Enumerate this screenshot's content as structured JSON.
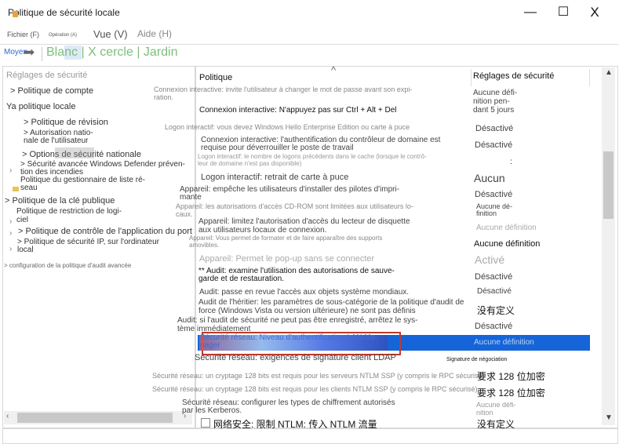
{
  "window": {
    "title": "Politique de sécurité locale",
    "minimize_label": "—",
    "maximize_label": "☐",
    "close_label": "X"
  },
  "menu": {
    "file": "Fichier (F)",
    "action": "Opération (A)",
    "view": "Vue (V)",
    "help": "Aide (H)"
  },
  "toolbar": {
    "moyen": "Moyen",
    "arrow": "➡",
    "path": "Blanc | X cercle | Jardin"
  },
  "left_tree": {
    "root": "Réglages de sécurité",
    "items": [
      "> Politique de compte",
      "Ya politique locale",
      "> Politique de révision",
      "> Autorisation natio-\nnale de l'utilisateur",
      "> Options de sécurité nationale",
      "> Sécurité avancée Windows Defender préven-\ntion des incendies",
      "Politique du gestionnaire de liste ré-\nseau",
      "> Politique de la clé publique",
      "Politique de restriction de logi-\nciel",
      "> Politique de contrôle de l'application du port",
      "> Politique de sécurité IP, sur l'ordinateur\nlocal",
      "> configuration de la politique d'audit avancée"
    ]
  },
  "right_list": {
    "col_policy": "Politique",
    "col_setting": "Réglages de sécurité",
    "rows": [
      {
        "policy": "Connexion interactive: invite l'utilisateur à changer le mot de passe avant son expi-\nration.",
        "setting": "Aucune défi-\nnition pen-\ndant 5 jours"
      },
      {
        "policy": "Connexion interactive: N'appuyez pas sur Ctrl + Alt + Del",
        "setting": ""
      },
      {
        "policy": "Logon interactif: vous devez Windows Hello Enterprise Edition ou carte à puce",
        "setting": "Désactivé"
      },
      {
        "policy": "Connexion interactive: l'authentification du contrôleur de domaine est\nrequise pour déverrouiller le poste de travail",
        "setting": "Désactivé"
      },
      {
        "policy": "Logon interactif: le nombre de logons précédents dans le cache (lorsque le contrô-\nleur de domaine n'est pas disponible)",
        "setting": ":"
      },
      {
        "policy": "Logon interactif: retrait de carte à puce",
        "setting": "Aucun"
      },
      {
        "policy": "Appareil: empêche les utilisateurs d'installer des pilotes d'impri-\nmante",
        "setting": "Désactivé"
      },
      {
        "policy": "Appareil: les autorisations d'accès CD-ROM sont limitées aux utilisateurs lo-\ncaux.",
        "setting": "Aucune dé-\nfinition"
      },
      {
        "policy": "Appareil: limitez l'autorisation d'accès du lecteur de disquette\naux utilisateurs locaux de connexion.",
        "setting": "Aucune définition"
      },
      {
        "policy": "Appareil: Vous permet de formater et de faire apparaître des supports\namovibles.",
        "setting": "Aucune définition"
      },
      {
        "policy": "Appareil: Permet le pop-up sans se connecter",
        "setting": "Activé"
      },
      {
        "policy": "** Audit: examine l'utilisation des autorisations de sauve-\ngarde et de restauration.",
        "setting": "Désactivé"
      },
      {
        "policy": "Audit: passe en revue l'accès aux objets système mondiaux.",
        "setting": "Désactivé"
      },
      {
        "policy": "Audit de l'héritier: les paramètres de sous-catégorie de la politique d'audit de\nforce (Windows Vista ou version ultérieure) ne sont pas définis",
        "setting": "没有定义"
      },
      {
        "policy": "Audit: si l'audit de sécurité ne peut pas être enregistré, arrêtez le sys-\ntème immédiatement",
        "setting": "Désactivé"
      },
      {
        "policy": "Sécurité réseau: Niveau d'authentification LAN Ma-\nnager",
        "setting": "Aucune définition"
      },
      {
        "policy": "Sécurité réseau: exigences de signature client LDAP",
        "setting": "Signature de négociation"
      },
      {
        "policy": "Sécurité réseau: un cryptage 128 bits est requis pour les serveurs NTLM SSP (y compris le RPC sécurisé)",
        "setting": "要求 128 位加密"
      },
      {
        "policy": "Sécurité réseau: un cryptage 128 bits est requis pour les clients NTLM SSP (y compris le RPC sécurisé)",
        "setting": "要求 128 位加密"
      },
      {
        "policy": "Sécurité réseau: configurer les types de chiffrement autorisés\npar les Kerberos.",
        "setting": "Aucune défi-\nnition"
      },
      {
        "policy": "网络安全: 限制 NTLM: 传入 NTLM 流量",
        "setting": "没有定义"
      }
    ]
  },
  "colors": {
    "selection": "#1565d8",
    "selection_border": "#c0392b",
    "toolbar_path": "#7cbf7c"
  }
}
